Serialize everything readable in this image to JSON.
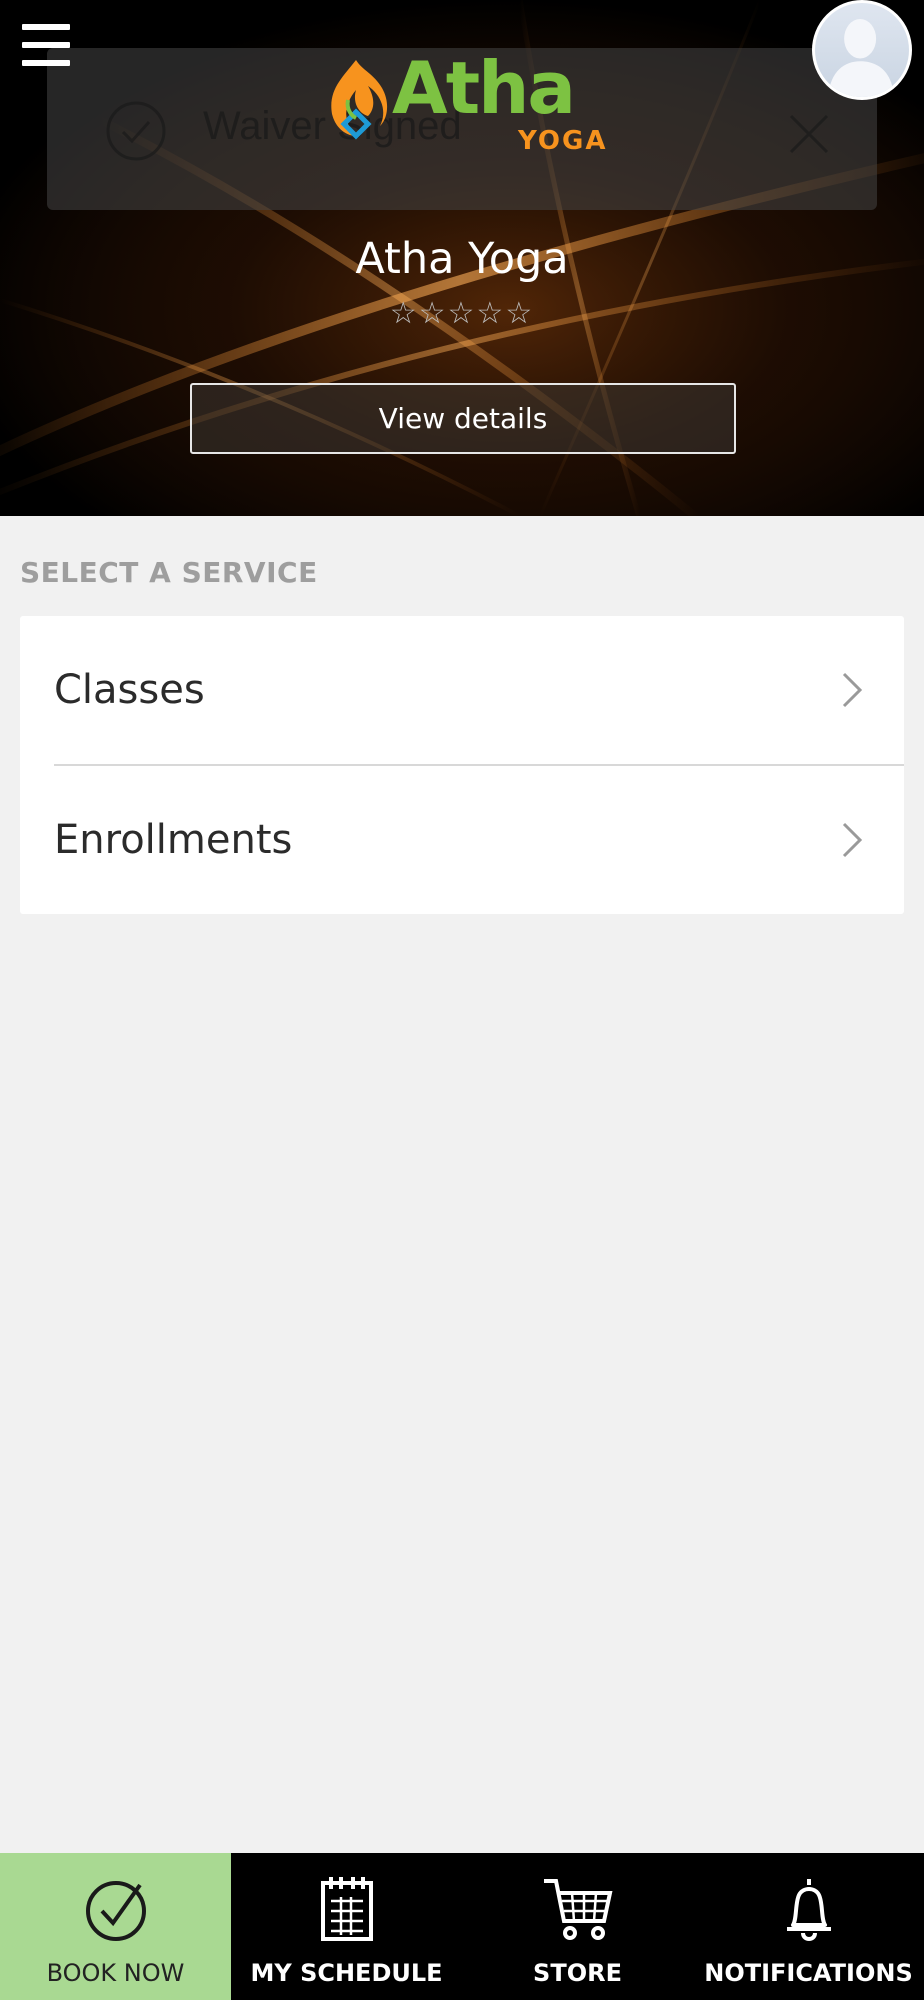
{
  "header": {
    "menu_icon": "hamburger-menu-icon",
    "avatar_icon": "user-avatar-icon"
  },
  "waiver_toast": {
    "text": "Waiver Signed",
    "check_icon": "check-circle-icon",
    "close_icon": "close-icon"
  },
  "brand": {
    "logo_word": "Atha",
    "logo_sub": "YOGA",
    "name": "Atha Yoga",
    "rating_stars": "☆☆☆☆☆",
    "rating": 0,
    "rating_max": 5,
    "colors": {
      "green": "#7dc242",
      "orange": "#f7931e",
      "blue": "#1e9ad6"
    }
  },
  "hero": {
    "view_details_label": "View details"
  },
  "services": {
    "section_title": "SELECT A SERVICE",
    "items": [
      {
        "label": "Classes",
        "icon": "chevron-right-icon"
      },
      {
        "label": "Enrollments",
        "icon": "chevron-right-icon"
      }
    ]
  },
  "bottom_nav": {
    "active_color": "#a9d992",
    "items": [
      {
        "label": "BOOK NOW",
        "icon": "check-circle-icon",
        "active": true
      },
      {
        "label": "MY SCHEDULE",
        "icon": "calendar-icon",
        "active": false
      },
      {
        "label": "STORE",
        "icon": "cart-icon",
        "active": false
      },
      {
        "label": "NOTIFICATIONS",
        "icon": "bell-icon",
        "active": false
      }
    ]
  }
}
